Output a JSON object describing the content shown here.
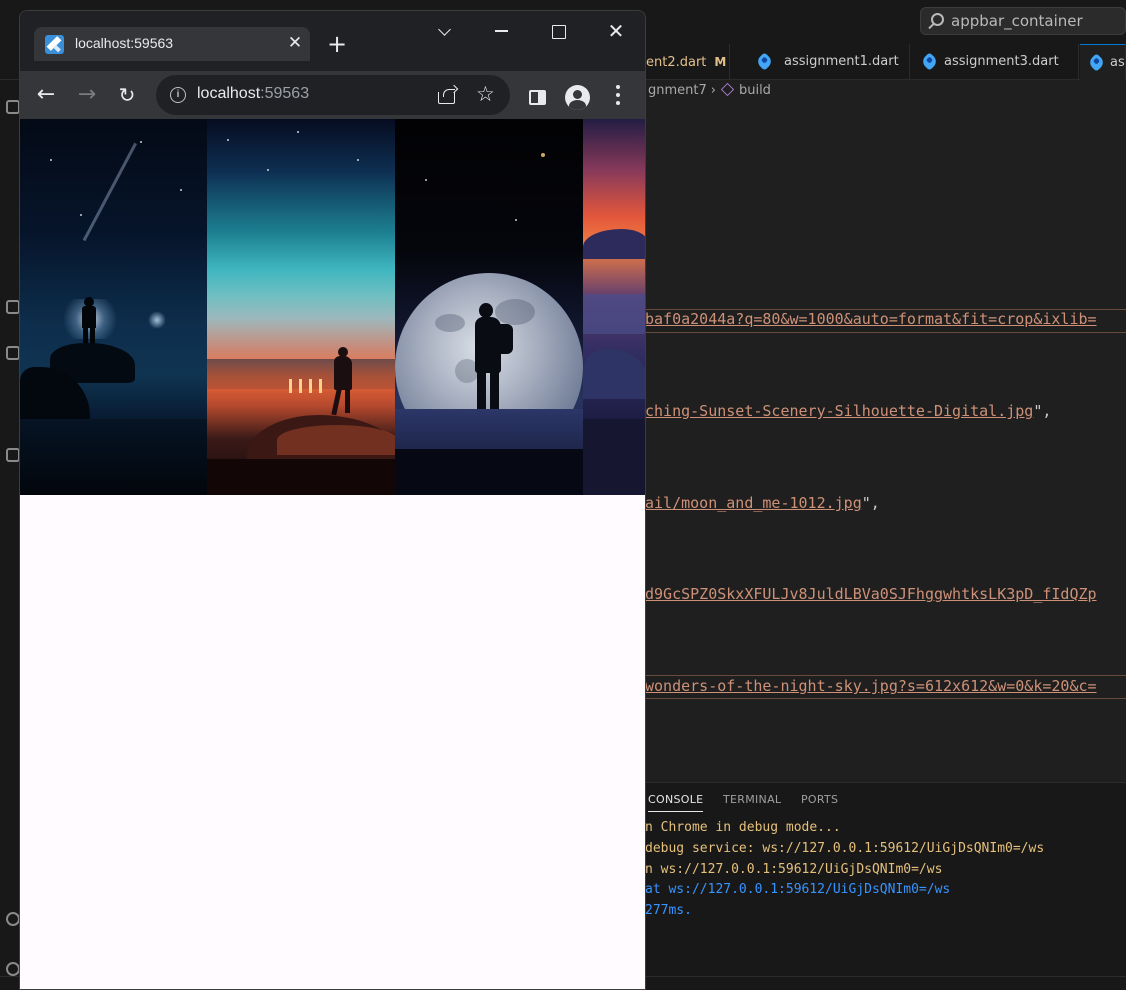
{
  "vscode": {
    "search_text": "appbar_container",
    "tabs": [
      {
        "label": "ent2.dart",
        "modified": "M"
      },
      {
        "label": "assignment1.dart"
      },
      {
        "label": "assignment3.dart"
      },
      {
        "label": "ass"
      }
    ],
    "breadcrumb": {
      "file": "gnment7",
      "symbol": "build"
    },
    "code_lines": [
      {
        "text": "baf0a2044a?q=80&w=1000&auto=format&fit=crop&ixlib="
      },
      {
        "text": "ching-Sunset-Scenery-Silhouette-Digital.jpg",
        "suffix": "\","
      },
      {
        "text": "ail/moon_and_me-1012.jpg",
        "suffix": "\","
      },
      {
        "text": "d9GcSPZ0SkxXFULJv8JuldLBVa0SJFhggwhtksLK3pD_fIdQZp"
      },
      {
        "text": "wonders-of-the-night-sky.jpg?s=612x612&w=0&k=20&c="
      }
    ],
    "panel_tabs": {
      "console": "CONSOLE",
      "terminal": "TERMINAL",
      "ports": "PORTS"
    },
    "console_lines": [
      {
        "text": "n Chrome in debug mode...",
        "color": "#e5c07b"
      },
      {
        "text": " debug service: ws://127.0.0.1:59612/UiGjDsQNIm0=/ws",
        "color": "#e5c07b"
      },
      {
        "text": "n ws://127.0.0.1:59612/UiGjDsQNIm0=/ws",
        "color": "#e5c07b"
      },
      {
        "text": "at ws://127.0.0.1:59612/UiGjDsQNIm0=/ws",
        "color": "#3794ff"
      },
      {
        "text": "277ms.",
        "color": "#3794ff"
      }
    ]
  },
  "chrome": {
    "tab_title": "localhost:59563",
    "tab_close": "✕",
    "new_tab": "+",
    "window_close": "✕",
    "url_host": "localhost",
    "url_port": ":59563",
    "info_icon": "i",
    "back": "←",
    "forward": "→",
    "reload": "↻",
    "star": "☆"
  },
  "page": {
    "background": "#fffbfe",
    "banner_images": [
      {
        "icon": "night-coast-silhouette-image"
      },
      {
        "icon": "sunset-silhouette-image"
      },
      {
        "icon": "moon-silhouette-image"
      },
      {
        "icon": "sunset-mountains-image"
      }
    ]
  }
}
